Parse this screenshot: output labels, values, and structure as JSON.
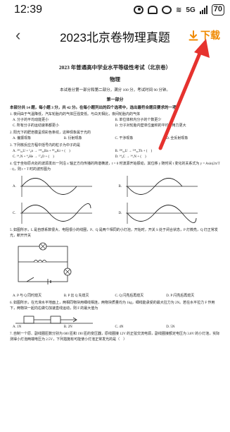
{
  "status_bar": {
    "time": "12:39",
    "network": "5G",
    "battery": "70"
  },
  "nav": {
    "back_icon": "chevron-left-icon",
    "title": "2023北京卷物理真题",
    "download_label": "下载"
  },
  "colors": {
    "accent": "#f08a00",
    "arrow": "#e6322e"
  },
  "doc": {
    "title": "2023 年普通高中学业水平等级性考试（北京卷）",
    "subject": "物理",
    "note": "本试卷分第一部分和第二部分，满分 100 分，考试时间 90 分钟。",
    "part1": "第一部分",
    "instructions": "本部分共 14 题，每小题 3 分，共 42 分。在每小题列出的四个选项中，选出最符合题目要求的一项。",
    "q1": "1. 夜间由于气温降低，汽车轮胎内的气体压强变低。与白天相比，夜间轮胎内的气体",
    "q1_opts": [
      "A. 分子的平均动能更小",
      "B. 单位体积内分子的个数更少",
      "C. 所有分子的运动速率都更小",
      "D. 分子对轮胎内壁单位面积的平均作用力更大"
    ],
    "q2": "2. 阳光下的肥皂膜呈现彩色条纹，这种现象属于光的",
    "q2_opts": [
      "A. 偏振现象",
      "B. 衍射现象",
      "C. 干涉现象",
      "D. 全反射现象"
    ],
    "q3": "3. 下列核反应方程中括号内的粒子为中子的是",
    "q3_opts": [
      "A. ²³⁵₉₂U + ¹₀n → ¹⁴⁴₅₆Ba + ⁸⁹₃₆Kr + (　)",
      "B. ²³⁸₉₂U → ²³⁴₉₀Th + (　)",
      "C. ¹⁴₇N + ⁴₂He → ¹⁷₈O + (　)",
      "D. ¹⁴₆C → ¹⁴₇N + (　)"
    ],
    "q4": "4. 位于坐标原点处的波源发出一列沿 x 轴正方向传播的简谐横波，t = 0 时波源开始振动，其位移 y 随时间 t 变化的关系式为 y = Asin(2π/T · t)，则 t = T 时的波形图为",
    "q4_labels": [
      "A.",
      "B.",
      "C.",
      "D."
    ],
    "q5": "5. 如图所示，L 是自感系数很大、电阻很小的线圈，P、Q 是两个相同的小灯泡，开始时，开关 S 处于闭合状态，P 灯微亮，Q 灯正常发光，断开开关",
    "q5_opts": [
      "A. P 与 Q 同时熄灭",
      "B. P 比 Q 先熄灭",
      "C. Q 闪亮后再熄灭",
      "D. P 闪亮后再熄灭"
    ],
    "q6": "6. 如图所示，在光滑水平地面上，两相同物块用细线相连，两物块质量均为 1kg，细线能承受的最大拉力为 2N。若在水平拉力 F 作用下，两物块一起向右做匀加速直线运动，则 F 的最大值为",
    "q6_opts": [
      "A. 1N",
      "B. 2N",
      "C. 4N",
      "D. 5N"
    ],
    "q7": "7. 自制一个原、副线圈匝数分别为 600 匝和 190 匝的变压器，原线圈接 12V 的正弦交流电源，副线圈接额定电压为 3.8V 的小灯泡，实际测得小灯泡两端电压为 2.5V，下列措施有可能使小灯泡正常发光的是（　）"
  }
}
